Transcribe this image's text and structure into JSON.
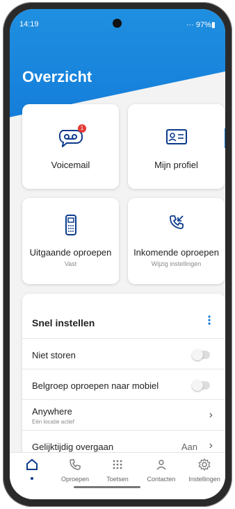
{
  "status": {
    "time": "14:19",
    "right": "··· 97%▮"
  },
  "header": {
    "title": "Overzicht"
  },
  "cards": {
    "voicemail": {
      "label": "Voicemail",
      "badge": "1"
    },
    "profiel": {
      "label": "Mijn profiel"
    },
    "uitgaande": {
      "label": "Uitgaande oproepen",
      "sub": "Vast"
    },
    "inkomende": {
      "label": "Inkomende oproepen",
      "sub": "Wijzig instellingen"
    }
  },
  "snel": {
    "title": "Snel instellen",
    "rows": [
      {
        "label": "Niet storen"
      },
      {
        "label": "Belgroep oproepen naar mobiel"
      },
      {
        "label": "Anywhere",
        "sub": "Eén locatie actief"
      },
      {
        "label": "Gelijktijdig overgaan",
        "value": "Aan"
      }
    ]
  },
  "nav": {
    "items": [
      {
        "label": ""
      },
      {
        "label": "Oproepen"
      },
      {
        "label": "Toetsen"
      },
      {
        "label": "Contacten"
      },
      {
        "label": "Instellingen"
      }
    ]
  },
  "colors": {
    "brand_blue": "#1279d8",
    "icon_navy": "#0b3a8c",
    "badge_red": "#e53935"
  }
}
